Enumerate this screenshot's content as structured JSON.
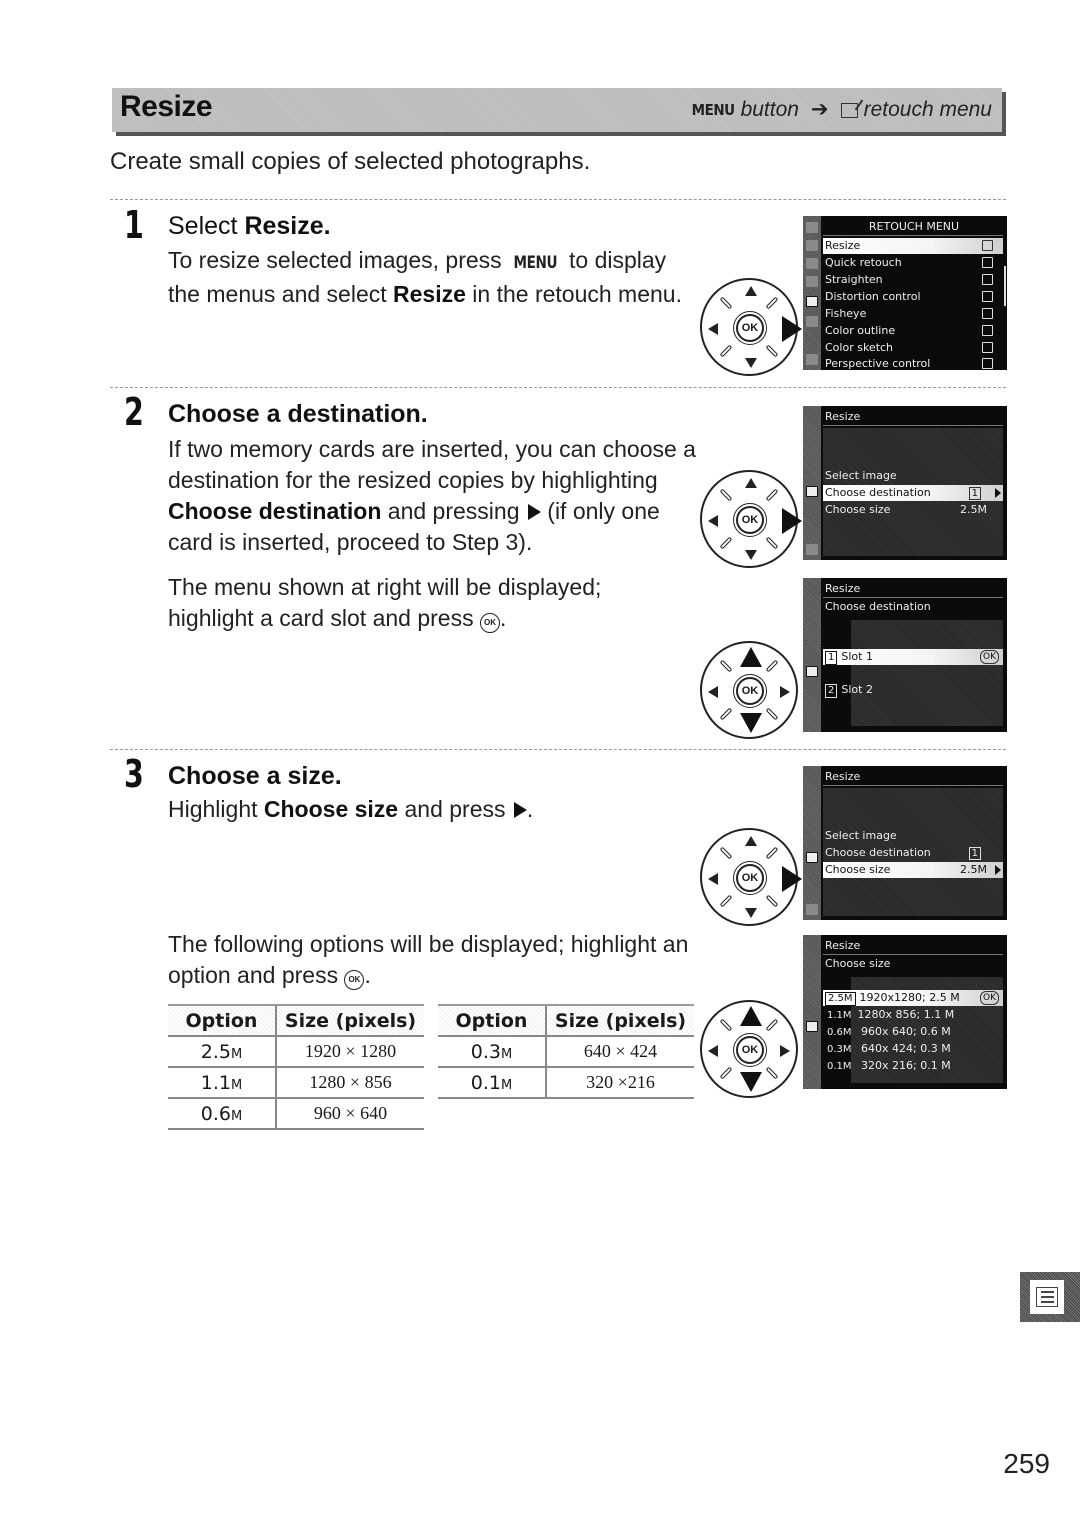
{
  "header": {
    "title": "Resize",
    "path_menu_key": "MENU",
    "path_button": "button",
    "path_arrow": "➔",
    "path_menu": "retouch menu"
  },
  "intro": "Create small copies of selected photographs.",
  "steps": [
    {
      "number": "1",
      "heading_prefix": "Select ",
      "heading_bold": "Resize.",
      "body": {
        "p1": "To resize selected images, press ",
        "menu_key": "MENU",
        "p2": " to display the menus and select ",
        "bold": "Resize",
        "p3": " in the retouch menu."
      }
    },
    {
      "number": "2",
      "heading": "Choose a destination.",
      "body": {
        "p1": "If two memory cards are inserted, you can choose a destination for the resized copies by highlighting ",
        "bold": "Choose destination",
        "p2": " and pressing ",
        "p3": " (if only one card is inserted, proceed to Step 3)."
      },
      "body2": {
        "p1": "The menu shown at right will be displayed; highlight a card slot and press ",
        "ok": "OK",
        "p2": "."
      }
    },
    {
      "number": "3",
      "heading": "Choose a size.",
      "body": {
        "p1": "Highlight ",
        "bold": "Choose size",
        "p2": " and press ",
        "p3": "."
      },
      "body2": {
        "p1": "The following options will be displayed; highlight an option and press ",
        "ok": "OK",
        "p2": "."
      }
    }
  ],
  "dial_ok_label": "OK",
  "screens": {
    "retouch_menu": {
      "title": "RETOUCH MENU",
      "items": [
        {
          "label": "Resize",
          "highlighted": true
        },
        {
          "label": "Quick retouch"
        },
        {
          "label": "Straighten"
        },
        {
          "label": "Distortion control"
        },
        {
          "label": "Fisheye"
        },
        {
          "label": "Color outline"
        },
        {
          "label": "Color sketch"
        },
        {
          "label": "Perspective control"
        }
      ]
    },
    "resize_dest": {
      "title": "Resize",
      "items": [
        {
          "label": "Select image"
        },
        {
          "label": "Choose destination",
          "value": "1",
          "highlighted": true
        },
        {
          "label": "Choose size",
          "value": "2.5M"
        }
      ]
    },
    "choose_dest": {
      "title": "Resize",
      "subtitle": "Choose destination",
      "items": [
        {
          "tag": "1",
          "label": "Slot 1",
          "ok": "OK",
          "highlighted": true
        },
        {
          "tag": "2",
          "label": "Slot 2"
        }
      ]
    },
    "resize_size": {
      "title": "Resize",
      "items": [
        {
          "label": "Select image"
        },
        {
          "label": "Choose destination",
          "value": "1"
        },
        {
          "label": "Choose size",
          "value": "2.5M",
          "highlighted": true
        }
      ]
    },
    "choose_size": {
      "title": "Resize",
      "subtitle": "Choose size",
      "items": [
        {
          "tag": "2.5M",
          "label": "1920x1280; 2.5 M",
          "ok": "OK",
          "highlighted": true
        },
        {
          "tag": "1.1M",
          "label": "1280x 856; 1.1 M"
        },
        {
          "tag": "0.6M",
          "label": " 960x 640; 0.6 M"
        },
        {
          "tag": "0.3M",
          "label": " 640x 424; 0.3 M"
        },
        {
          "tag": "0.1M",
          "label": " 320x 216; 0.1 M"
        }
      ]
    }
  },
  "size_table": {
    "headers": [
      "Option",
      "Size (pixels)"
    ],
    "left_rows": [
      {
        "option": "2.5",
        "unit": "M",
        "size": "1920 × 1280"
      },
      {
        "option": "1.1",
        "unit": "M",
        "size": "1280 × 856"
      },
      {
        "option": "0.6",
        "unit": "M",
        "size": "960 × 640"
      }
    ],
    "right_rows": [
      {
        "option": "0.3",
        "unit": "M",
        "size": "640 × 424"
      },
      {
        "option": "0.1",
        "unit": "M",
        "size": "320 ×216"
      }
    ]
  },
  "page_number": "259"
}
